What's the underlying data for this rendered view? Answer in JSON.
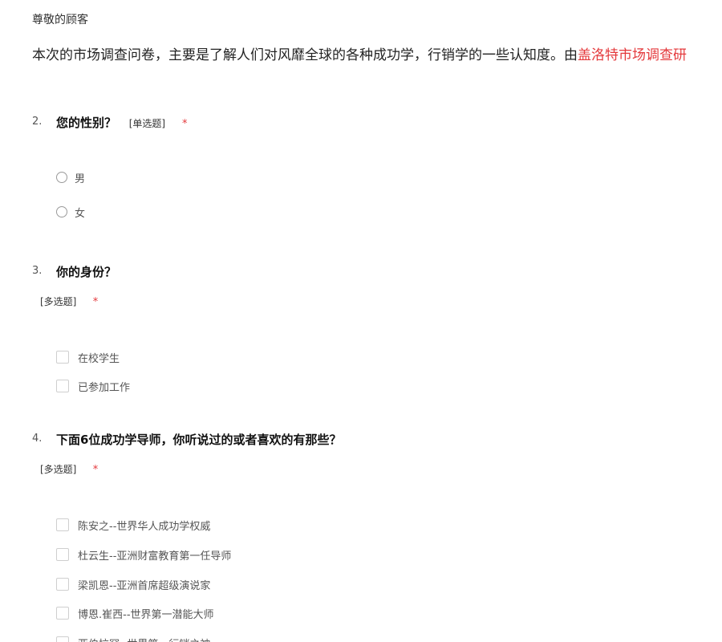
{
  "greeting": "尊敬的顾客",
  "intro": {
    "text": "本次的市场调查问卷，主要是了解人们对风靡全球的各种成功学，行销学的一些认知度。由",
    "highlight": "盖洛特市场调查研"
  },
  "questions": [
    {
      "number": "2.",
      "title": "您的性别？",
      "type": "[单选题]",
      "required": "*",
      "options": [
        "男",
        "女"
      ]
    },
    {
      "number": "3.",
      "title": "你的身份？",
      "type": "[多选题]",
      "required": "*",
      "options": [
        "在校学生",
        "已参加工作"
      ]
    },
    {
      "number": "4.",
      "title": "下面6位成功学导师，你听说过的或者喜欢的有那些？",
      "type": "[多选题]",
      "required": "*",
      "options": [
        "陈安之--世界华人成功学权威",
        "杜云生--亚洲财富教育第一任导师",
        "梁凯恩--亚洲首席超级演说家",
        "博恩.崔西--世界第一潜能大师",
        "亚伯拉罕--世界第一行销之神"
      ]
    }
  ],
  "colors": {
    "accent_red": "#e4393c",
    "text_dark": "#111111",
    "text_muted": "#555555"
  }
}
